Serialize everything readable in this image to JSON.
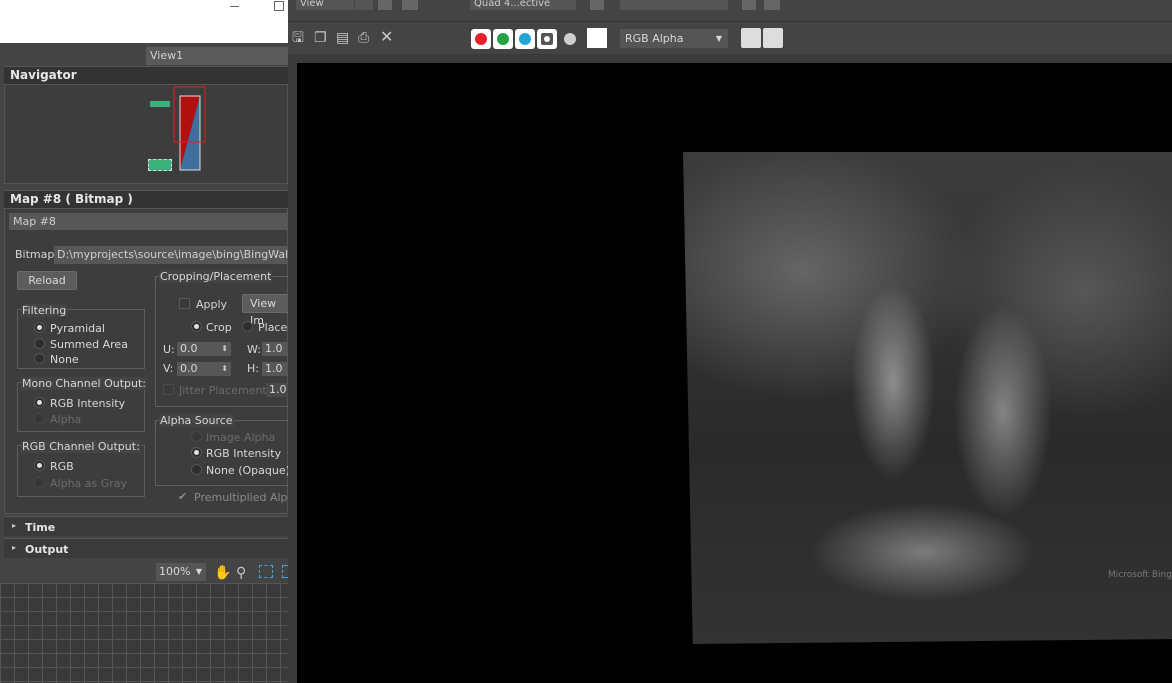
{
  "colors": {
    "red": "#e8202a",
    "green": "#25a244",
    "cyan": "#22a6d8",
    "background": "#444444"
  },
  "top": {
    "view_dropdown": "View",
    "quad_dropdown": "Quad 4...ective"
  },
  "viewer_tab": "View1",
  "navigator": {
    "title": "Navigator"
  },
  "map": {
    "title": "Map #8  ( Bitmap )",
    "name": "Map #8",
    "bitmap_label": "Bitmap:",
    "bitmap_path": "D:\\myprojects\\source\\image\\bing\\BingWallpaper",
    "reload": "Reload",
    "filtering": {
      "title": "Filtering",
      "options": [
        "Pyramidal",
        "Summed Area",
        "None"
      ],
      "selected": "Pyramidal"
    },
    "mono": {
      "title": "Mono Channel Output:",
      "options": [
        "RGB Intensity",
        "Alpha"
      ],
      "selected": "RGB Intensity"
    },
    "rgb": {
      "title": "RGB Channel Output:",
      "options": [
        "RGB",
        "Alpha as Gray"
      ],
      "selected": "RGB"
    },
    "cropping": {
      "title": "Cropping/Placement",
      "apply": "Apply",
      "view_image": "View Im",
      "crop": "Crop",
      "place": "Place",
      "u_label": "U:",
      "u_value": "0.0",
      "v_label": "V:",
      "v_value": "0.0",
      "w_label": "W:",
      "w_value": "1.0",
      "h_label": "H:",
      "h_value": "1.0",
      "jitter": "Jitter Placement:",
      "jitter_value": "1.0"
    },
    "alpha": {
      "title": "Alpha Source",
      "options": [
        "Image Alpha",
        "RGB Intensity",
        "None (Opaque)"
      ],
      "selected": "RGB Intensity"
    },
    "premultiplied": "Premultiplied Alpha"
  },
  "rollouts": {
    "time": "Time",
    "output": "Output"
  },
  "zoom": "100%",
  "channel_dropdown": "RGB Alpha",
  "watermark": "Microsoft Bing"
}
